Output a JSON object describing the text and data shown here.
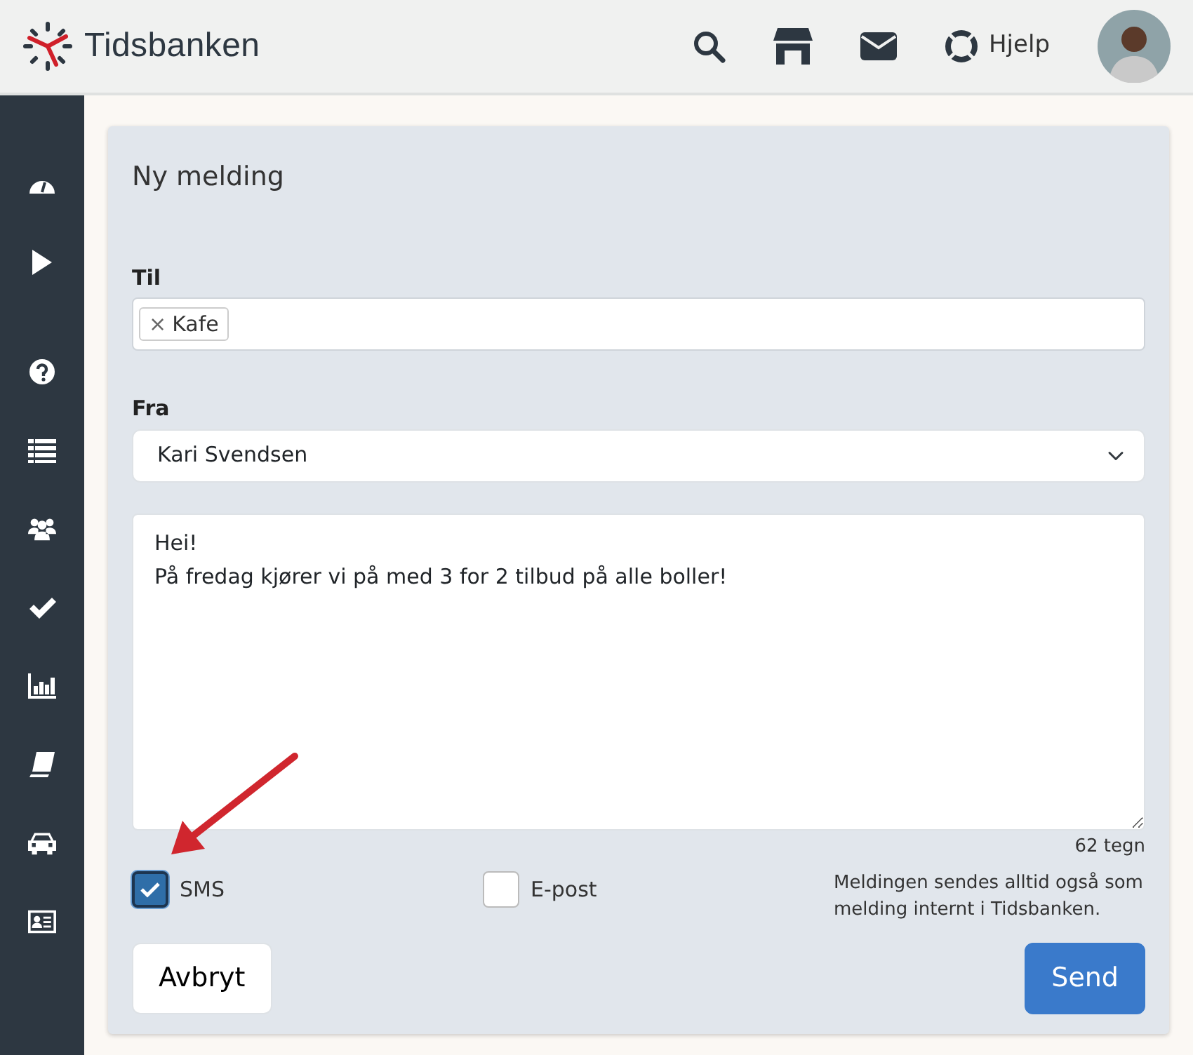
{
  "header": {
    "logo": "Tidsbanken",
    "help_label": "Hjelp"
  },
  "form": {
    "title": "Ny melding",
    "to": {
      "label": "Til",
      "tokens": [
        "Kafe"
      ],
      "remove_symbol": "×"
    },
    "from": {
      "label": "Fra",
      "value": "Kari Svendsen"
    },
    "message": {
      "value": "Hei!\nPå fredag kjører vi på med 3 for 2 tilbud på alle boller!",
      "counter": "62 tegn"
    },
    "channels": [
      {
        "label": "SMS",
        "checked": true
      },
      {
        "label": "E-post",
        "checked": false
      }
    ],
    "note": "Meldingen sendes alltid også som melding internt i Tidsbanken.",
    "buttons": [
      {
        "label": "Avbryt",
        "kind": "secondary"
      },
      {
        "label": "Send",
        "kind": "primary"
      }
    ]
  }
}
